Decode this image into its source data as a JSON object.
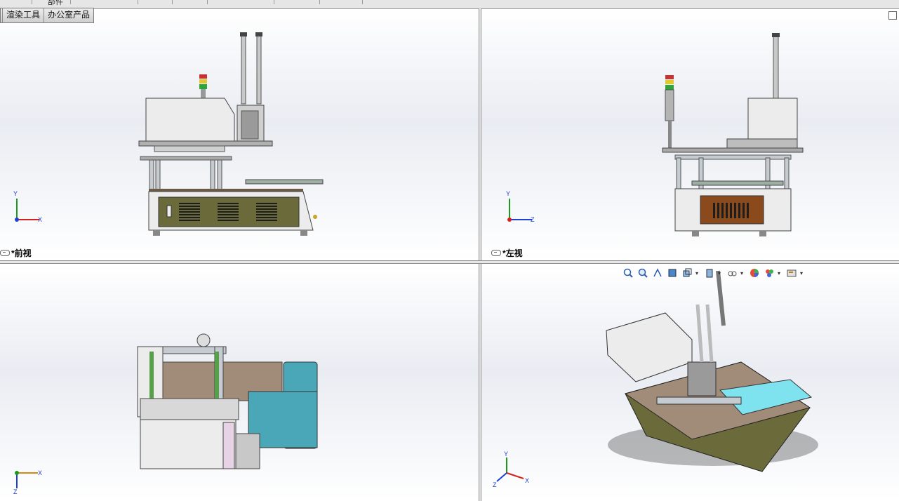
{
  "command_manager": {
    "tabs": [
      "",
      "渲染工具",
      "办公室产品"
    ],
    "top_partial": "部件"
  },
  "viewports": {
    "front": {
      "label": "*前视",
      "triad": {
        "axis1": "Y",
        "axis2": "X"
      }
    },
    "left": {
      "label": "*左视",
      "triad": {
        "axis1": "Y",
        "axis2": "Z"
      }
    },
    "top": {
      "label": "",
      "triad": {
        "axis1": "X",
        "axis2": "Z"
      }
    },
    "iso": {
      "label": "",
      "triad": {
        "axis1": "Y",
        "axis2": "X",
        "axis3": "Z"
      }
    }
  },
  "heads_up_toolbar": {
    "icons": [
      "zoom-to-fit-icon",
      "zoom-to-area-icon",
      "previous-view-icon",
      "section-view-icon",
      "view-orientation-icon",
      "display-style-icon",
      "hide-show-items-icon",
      "edit-appearance-icon",
      "apply-scene-icon",
      "view-settings-icon"
    ]
  },
  "colors": {
    "base_olive": "#6b6a3a",
    "panel_white": "#ececec",
    "frame_gray": "#b9bec3",
    "fixture_cyan": "#4aa7b8",
    "plate_tan": "#a08c78",
    "axis_red": "#d42020",
    "axis_green": "#1d9a1d",
    "axis_blue": "#1f3fd0"
  }
}
